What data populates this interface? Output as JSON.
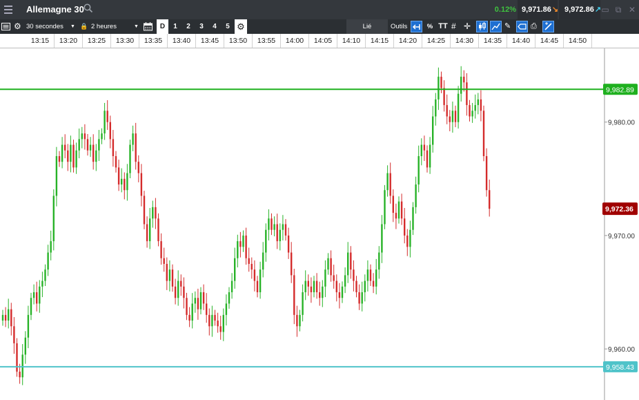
{
  "window": {
    "title": "Allemagne 30",
    "change": "0.12%",
    "sell_price": "9,971.86",
    "buy_price": "9,972.86"
  },
  "toolbar": {
    "interval": "30 secondes",
    "range": "2 heures",
    "day_label": "D",
    "shortcuts": [
      "1",
      "2",
      "3",
      "4",
      "5"
    ],
    "link_label": "Lié",
    "tools_label": "Outils",
    "percent_label": "%",
    "text_tool_label": "TT"
  },
  "time_axis": {
    "labels": [
      "13:15",
      "13:20",
      "13:25",
      "13:30",
      "13:35",
      "13:40",
      "13:45",
      "13:50",
      "13:55",
      "14:00",
      "14:05",
      "14:10",
      "14:15",
      "14:20",
      "14:25",
      "14:30",
      "14:35",
      "14:40",
      "14:45",
      "14:50"
    ]
  },
  "colors": {
    "up": "#27b227",
    "down": "#d42b2b",
    "resistance_line": "#1fb01f",
    "support_line": "#4fc3c9",
    "current_price_tag": "#a00000"
  },
  "chart_data": {
    "type": "candlestick",
    "instrument": "Allemagne 30",
    "ylim": [
      9955.5,
      9986.5
    ],
    "y_ticks": [
      "9,980.00",
      "9,970.00",
      "9,960.00"
    ],
    "y_tick_values": [
      9980,
      9970,
      9960
    ],
    "resistance": {
      "value": 9982.89,
      "label": "9,982.89"
    },
    "support": {
      "value": 9958.43,
      "label": "9,958.43"
    },
    "current_price": {
      "value": 9972.36,
      "label": "9,972.36"
    },
    "x_start": "13:12:30",
    "bar_interval_seconds": 30,
    "closes": [
      9963,
      9962.5,
      9963.5,
      9962,
      9960.5,
      9958,
      9957.5,
      9959.5,
      9961,
      9963,
      9964.5,
      9965,
      9964,
      9965.5,
      9966,
      9967,
      9968.5,
      9969.5,
      9973.5,
      9977,
      9976.5,
      9978,
      9977.5,
      9976.5,
      9978,
      9976,
      9977.5,
      9978.5,
      9979,
      9978.5,
      9977.5,
      9978,
      9976.5,
      9977.5,
      9978.5,
      9979,
      9981,
      9980,
      9978.5,
      9977,
      9976,
      9974.5,
      9975,
      9974,
      9975.5,
      9978,
      9979,
      9976.5,
      9975.5,
      9973.5,
      9971,
      9969.5,
      9971.5,
      9972.5,
      9971.5,
      9969.5,
      9968,
      9967.5,
      9966,
      9967,
      9965.5,
      9964.5,
      9966,
      9965.5,
      9964.5,
      9963,
      9962.5,
      9964,
      9964.5,
      9963.5,
      9965,
      9964,
      9963,
      9962,
      9963,
      9962.5,
      9962,
      9961.5,
      9963,
      9964,
      9965,
      9966,
      9968,
      9969.5,
      9969,
      9970,
      9968,
      9967.5,
      9967,
      9966,
      9965,
      9967,
      9968.5,
      9970.5,
      9971.5,
      9970.5,
      9971,
      9969.5,
      9970.5,
      9971,
      9970,
      9968.5,
      9966.5,
      9963,
      9962,
      9963,
      9965,
      9966,
      9965.5,
      9965,
      9966,
      9965,
      9964.5,
      9965.5,
      9967,
      9968,
      9966.5,
      9966,
      9965,
      9964.5,
      9965.5,
      9966.5,
      9968.5,
      9967,
      9966,
      9965,
      9964,
      9965,
      9966,
      9967,
      9966,
      9965.5,
      9967,
      9968.5,
      9971,
      9974,
      9975.5,
      9973.5,
      9972,
      9971.5,
      9973,
      9971.5,
      9970,
      9969,
      9970.5,
      9972.5,
      9974.5,
      9977,
      9978,
      9977.5,
      9976,
      9978,
      9980.5,
      9982,
      9984,
      9983,
      9981.5,
      9980.5,
      9980,
      9981,
      9980,
      9982.5,
      9984,
      9983.5,
      9981.5,
      9980.5,
      9981,
      9981.5,
      9982,
      9981,
      9977,
      9974,
      9972.36
    ]
  }
}
